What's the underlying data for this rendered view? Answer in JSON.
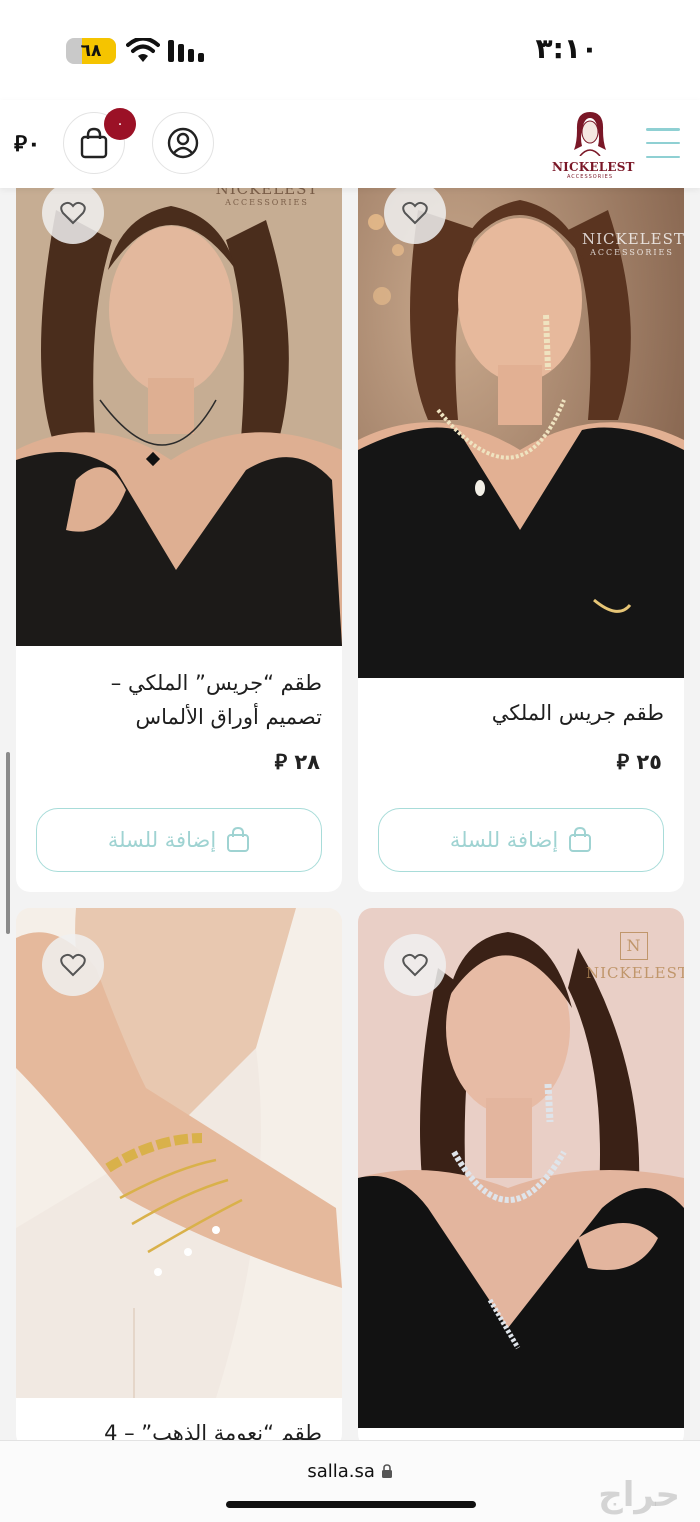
{
  "status_bar": {
    "time": "٣:١٠",
    "battery": "٦٨",
    "battery_level": 0.68
  },
  "header": {
    "cart_total": "٠",
    "currency_icon": "riyal-icon",
    "cart_badge": "٠",
    "logo_text": "NICKELEST",
    "logo_sub": "ACCESSORIES"
  },
  "products": [
    {
      "title_line1": "طقم جريس الملكي",
      "title_line2": "",
      "price": "٢٥ ⃁",
      "add_label": "إضافة للسلة",
      "watermark": "NICKELEST",
      "watermark_sub": "ACCESSORIES"
    },
    {
      "title_line1": "طقم “جريس” الملكي –",
      "title_line2": "تصميم أوراق الألماس",
      "price": "٢٨ ⃁",
      "add_label": "إضافة للسلة",
      "watermark": "NICKELEST",
      "watermark_sub": "ACCESSORIES"
    },
    {
      "title_line1": "",
      "watermark": "NICKELEST"
    },
    {
      "title_line1": "طقم “نعومة الذهب” – 4"
    }
  ],
  "browser": {
    "url": "salla.sa",
    "watermark": "حراج"
  },
  "colors": {
    "accent": "#8fd0d3",
    "badge": "#9b1126",
    "logo": "#7a1727"
  }
}
